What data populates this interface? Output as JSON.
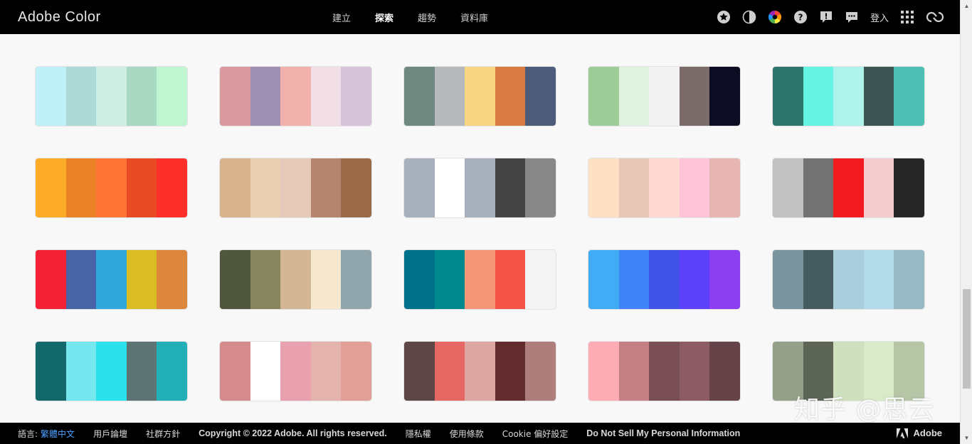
{
  "header": {
    "brand": "Adobe Color",
    "nav": [
      {
        "label": "建立",
        "active": false
      },
      {
        "label": "探索",
        "active": true
      },
      {
        "label": "趨勢",
        "active": false
      },
      {
        "label": "資料庫",
        "active": false
      }
    ],
    "tools": [
      "star-icon",
      "contrast-icon",
      "color-wheel-icon",
      "help-icon",
      "report-icon",
      "chat-icon"
    ],
    "signin": "登入",
    "apps_icon": "apps-grid-icon",
    "cc_icon": "creative-cloud-icon"
  },
  "palettes": [
    [
      "#bff0f7",
      "#acd8d6",
      "#cdefe3",
      "#aad9c3",
      "#c0f5d2"
    ],
    [
      "#d89a9e",
      "#9d90b2",
      "#f1b1ab",
      "#f2dfe5",
      "#d6c2d9"
    ],
    [
      "#6f8980",
      "#b6b9bb",
      "#f9d681",
      "#d87b43",
      "#4e5c7c"
    ],
    [
      "#9ecc98",
      "#e0f1e0",
      "#f2f2f2",
      "#7b6c69",
      "#0c0c22"
    ],
    [
      "#2e756c",
      "#66f4e4",
      "#aef2ec",
      "#3d5653",
      "#4ebfb3"
    ],
    [
      "#fcac26",
      "#e98125",
      "#ff7434",
      "#e84a23",
      "#fd3029"
    ],
    [
      "#d9b38e",
      "#e9d0b1",
      "#e5cab9",
      "#b4846d",
      "#9a6a47"
    ],
    [
      "#a6b1bd",
      "#ffffff",
      "#a6b1bd",
      "#444444",
      "#888888"
    ],
    [
      "#fee0c4",
      "#e6c6b4",
      "#ffd9d4",
      "#ffc4d8",
      "#e7b5b2"
    ],
    [
      "#c1c1c1",
      "#727272",
      "#f21b20",
      "#f3cdd0",
      "#262626"
    ],
    [
      "#f32136",
      "#4964a6",
      "#32a7db",
      "#dabd23",
      "#dc873c"
    ],
    [
      "#4f573c",
      "#86855f",
      "#d3b795",
      "#f6e8cf",
      "#90a5ac"
    ],
    [
      "#00718b",
      "#00898c",
      "#f39677",
      "#f35447",
      "#f4f4f4"
    ],
    [
      "#41abf5",
      "#3f83f7",
      "#4153e6",
      "#5d40f9",
      "#8b3ff0"
    ],
    [
      "#7a959d",
      "#465b5f",
      "#a9cfdc",
      "#b1dbe8",
      "#96b9c4"
    ],
    [
      "#13686c",
      "#75e8ef",
      "#2ae1ec",
      "#5e7474",
      "#22afb7"
    ],
    [
      "#d58a8e",
      "#ffffff",
      "#e9a1b0",
      "#e4b3ae",
      "#e29f97"
    ],
    [
      "#5d4646",
      "#e56864",
      "#dca6a3",
      "#632d2f",
      "#ae7e7d"
    ],
    [
      "#fdacb4",
      "#c47f84",
      "#7a4e55",
      "#8c5b63",
      "#664349"
    ],
    [
      "#95a088",
      "#5b6455",
      "#cfe0be",
      "#d8eac8",
      "#b5c5a6"
    ]
  ],
  "footer": {
    "lang_label": "語言:",
    "lang_value": "繁體中文",
    "links": [
      "用戶論壇",
      "社群方針"
    ],
    "copyright": "Copyright © 2022 Adobe. All rights reserved.",
    "links2": [
      "隱私權",
      "使用條款",
      "Cookie 偏好設定",
      "Do Not Sell My Personal Information"
    ],
    "adobe": "Adobe"
  },
  "watermark": "知乎 @思云",
  "colors": {
    "topbar_bg": "#000000",
    "footer_bg": "#000000",
    "page_bg": "#f8f8f8",
    "link_blue": "#4aa0ff"
  }
}
